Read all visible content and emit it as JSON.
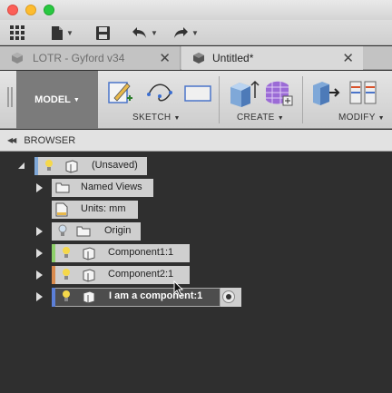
{
  "tabs": [
    {
      "label": "LOTR - Gyford v34",
      "close": "✕"
    },
    {
      "label": "Untitled*",
      "close": "✕"
    }
  ],
  "ribbon": {
    "workspace": "MODEL",
    "groups": [
      "SKETCH",
      "CREATE",
      "MODIFY"
    ]
  },
  "browser": {
    "title": "BROWSER",
    "root": "(Unsaved)",
    "items": [
      {
        "label": "Named Views"
      },
      {
        "label": "Units: mm"
      },
      {
        "label": "Origin"
      },
      {
        "label": "Component1:1",
        "color": "#8fd16a"
      },
      {
        "label": "Component2:1",
        "color": "#d98b4e"
      },
      {
        "label": "I am a component:1",
        "color": "#5b7fd8"
      }
    ],
    "root_color": "#7fa8d8"
  },
  "icons": [
    "grid-icon",
    "file-icon",
    "save-icon",
    "undo-icon",
    "redo-icon",
    "lightbulb-icon",
    "folder-icon",
    "component-icon",
    "ruler-icon",
    "radio-icon",
    "cursor-icon"
  ]
}
